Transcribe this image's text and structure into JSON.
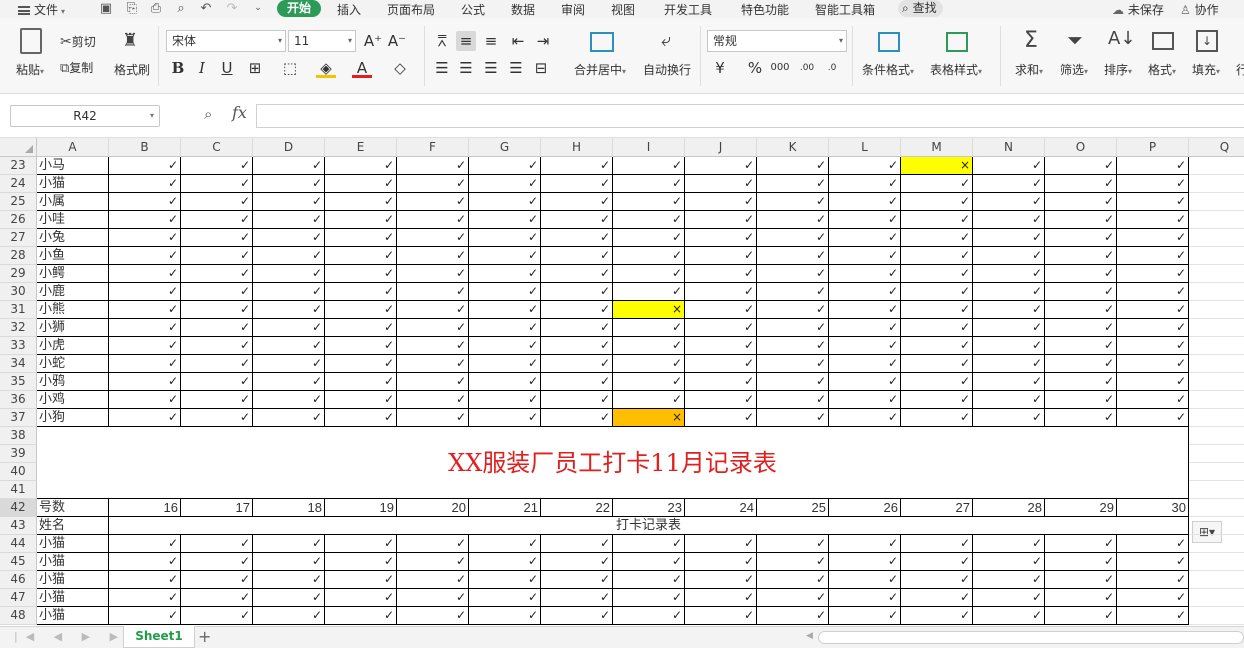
{
  "menubar": {
    "file": "文件",
    "tabs": [
      "开始",
      "插入",
      "页面布局",
      "公式",
      "数据",
      "审阅",
      "视图",
      "开发工具",
      "特色功能",
      "智能工具箱"
    ],
    "search": "查找",
    "unsaved": "未保存",
    "collab": "协作"
  },
  "ribbon": {
    "paste": "粘贴",
    "cut": "剪切",
    "copy": "复制",
    "format_painter": "格式刷",
    "font_name": "宋体",
    "font_size": "11",
    "merge_center": "合并居中",
    "wrap_text": "自动换行",
    "number_format": "常规",
    "cond_format": "条件格式",
    "table_style": "表格样式",
    "sum": "求和",
    "filter": "筛选",
    "sort": "排序",
    "format": "格式",
    "fill": "填充",
    "row_col": "行"
  },
  "formula_bar": {
    "name_box": "R42",
    "fx": "fx",
    "formula": ""
  },
  "columns": [
    "A",
    "B",
    "C",
    "D",
    "E",
    "F",
    "G",
    "H",
    "I",
    "J",
    "K",
    "L",
    "M",
    "N",
    "O",
    "P",
    "Q"
  ],
  "check": "✓",
  "cross": "×",
  "upper_rows": [
    {
      "row": "23",
      "name": "小马"
    },
    {
      "row": "24",
      "name": "小猫"
    },
    {
      "row": "25",
      "name": "小属"
    },
    {
      "row": "26",
      "name": "小哇"
    },
    {
      "row": "27",
      "name": "小兔"
    },
    {
      "row": "28",
      "name": "小鱼"
    },
    {
      "row": "29",
      "name": "小鳄"
    },
    {
      "row": "30",
      "name": "小鹿"
    },
    {
      "row": "31",
      "name": "小熊"
    },
    {
      "row": "32",
      "name": "小狮"
    },
    {
      "row": "33",
      "name": "小虎"
    },
    {
      "row": "34",
      "name": "小蛇"
    },
    {
      "row": "35",
      "name": "小鸦"
    },
    {
      "row": "36",
      "name": "小鸡"
    },
    {
      "row": "37",
      "name": "小狗"
    }
  ],
  "absences": [
    {
      "row": "23",
      "col": "M",
      "color": "#ffff00"
    },
    {
      "row": "31",
      "col": "I",
      "color": "#ffff00"
    },
    {
      "row": "37",
      "col": "I",
      "color": "#ffbf00"
    }
  ],
  "title_rows": [
    "38",
    "39",
    "40",
    "41"
  ],
  "title": "XX服装厂员工打卡11月记录表",
  "header_row": {
    "row": "42",
    "label": "号数",
    "days": [
      "16",
      "17",
      "18",
      "19",
      "20",
      "21",
      "22",
      "23",
      "24",
      "25",
      "26",
      "27",
      "28",
      "29",
      "30"
    ]
  },
  "sub_header_row": {
    "row": "43",
    "label": "姓名",
    "text": "打卡记录表"
  },
  "lower_rows": [
    {
      "row": "44",
      "name": "小猫"
    },
    {
      "row": "45",
      "name": "小猫"
    },
    {
      "row": "46",
      "name": "小猫"
    },
    {
      "row": "47",
      "name": "小猫"
    },
    {
      "row": "48",
      "name": "小猫"
    }
  ],
  "sheets": [
    "Sheet1"
  ]
}
